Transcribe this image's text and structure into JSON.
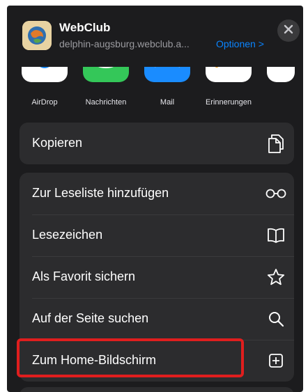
{
  "header": {
    "title": "WebClub",
    "subtitle": "delphin-augsburg.webclub.a...",
    "options_label": "Optionen >"
  },
  "share_row": [
    {
      "label": "AirDrop",
      "icon": "airdrop-icon",
      "color": "#1a8cff"
    },
    {
      "label": "Nachrichten",
      "icon": "messages-icon",
      "color": "#34c759"
    },
    {
      "label": "Mail",
      "icon": "mail-icon",
      "color": "#1a8cff"
    },
    {
      "label": "Erinnerungen",
      "icon": "reminders-icon",
      "color": "#ffffff"
    }
  ],
  "groups": {
    "copy": {
      "label": "Kopieren",
      "icon": "copy-icon"
    },
    "actions": [
      {
        "label": "Zur Leseliste hinzufügen",
        "icon": "reading-list-icon"
      },
      {
        "label": "Lesezeichen",
        "icon": "bookmark-icon"
      },
      {
        "label": "Als Favorit sichern",
        "icon": "star-icon"
      },
      {
        "label": "Auf der Seite suchen",
        "icon": "search-icon"
      },
      {
        "label": "Zum Home-Bildschirm",
        "icon": "add-square-icon"
      }
    ]
  },
  "colors": {
    "sheet_bg": "#1c1c1e",
    "group_bg": "#2c2c2e",
    "accent": "#0a84ff",
    "highlight": "#e01e1e"
  }
}
